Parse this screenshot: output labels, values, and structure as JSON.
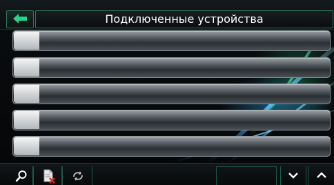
{
  "header": {
    "title": "Подключенные устройства",
    "back_icon": "arrow-left-icon"
  },
  "device_list": {
    "items": [
      {
        "label": ""
      },
      {
        "label": ""
      },
      {
        "label": ""
      },
      {
        "label": ""
      },
      {
        "label": ""
      }
    ]
  },
  "toolbar": {
    "buttons": [
      {
        "icon": "search-icon"
      },
      {
        "icon": "delete-device-icon"
      },
      {
        "icon": "refresh-icon"
      },
      {
        "icon": "empty-slot"
      },
      {
        "icon": "empty-slot"
      },
      {
        "icon": "chevron-down-icon"
      },
      {
        "icon": "chevron-up-icon"
      }
    ]
  },
  "colors": {
    "accent_green": "#2a7a58",
    "arrow_green": "#28d48c",
    "delete_red": "#e02020"
  }
}
